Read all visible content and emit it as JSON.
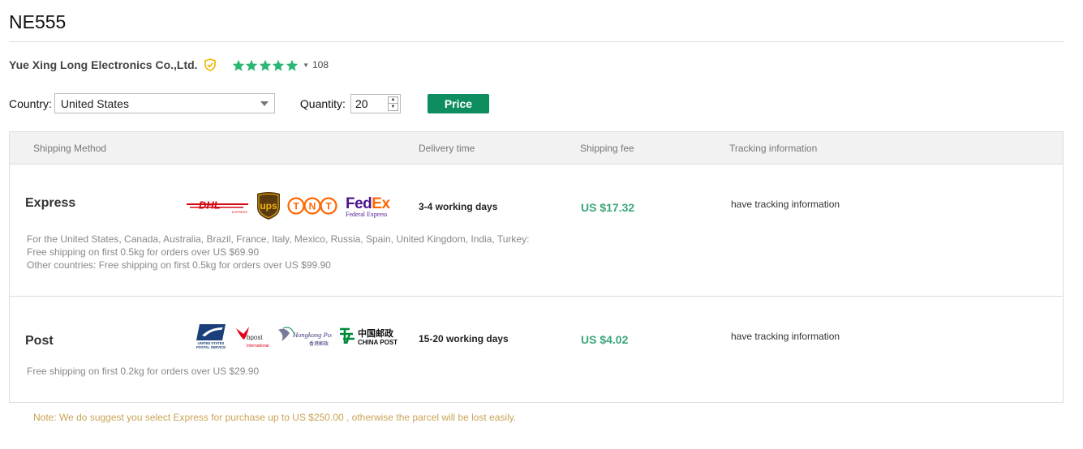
{
  "product": {
    "title": "NE555"
  },
  "seller": {
    "name": "Yue Xing Long Electronics Co.,Ltd.",
    "rating_count": "108",
    "stars": 5,
    "star_color": "#2bb673",
    "badge_color": "#f0b400"
  },
  "filters": {
    "country_label": "Country:",
    "country_value": "United States",
    "quantity_label": "Quantity:",
    "quantity_value": "20",
    "price_button": "Price",
    "button_color": "#0e8e5e"
  },
  "table": {
    "headers": {
      "method": "Shipping Method",
      "delivery": "Delivery time",
      "fee": "Shipping fee",
      "tracking": "Tracking information"
    },
    "rows": [
      {
        "method": "Express",
        "delivery": "3-4 working days",
        "fee": "US $17.32",
        "tracking": "have tracking information",
        "desc": [
          "For the United States, Canada, Australia, Brazil, France, Italy, Mexico, Russia, Spain, United Kingdom, India, Turkey:",
          "Free shipping on first 0.5kg for orders over US $69.90",
          "Other countries: Free shipping on first 0.5kg for orders over US $99.90"
        ],
        "carriers": {
          "dhl": {
            "name": "DHL",
            "sub": "EXPRESS"
          },
          "ups": {
            "name": "ups"
          },
          "tnt": {
            "letters": [
              "T",
              "N",
              "T"
            ]
          },
          "fedex": {
            "fed": "Fed",
            "ex": "Ex",
            "sub": "Federal Express"
          }
        }
      },
      {
        "method": "Post",
        "delivery": "15-20 working days",
        "fee": "US $4.02",
        "tracking": "have tracking information",
        "desc": [
          "Free shipping on first 0.2kg for orders over US $29.90"
        ],
        "carriers": {
          "usps": {
            "line1": "UNITED STATES",
            "line2": "POSTAL SERVICE"
          },
          "bpost": {
            "name": "bpost",
            "sub": "International"
          },
          "hkpost": {
            "name": "Hongkong Post",
            "sub": "香港郵政"
          },
          "chinapost": {
            "cn": "中国邮政",
            "en": "CHINA POST"
          }
        }
      }
    ]
  },
  "note": "Note: We do suggest you select Express for purchase up to US $250.00 , otherwise the parcel will be lost easily."
}
